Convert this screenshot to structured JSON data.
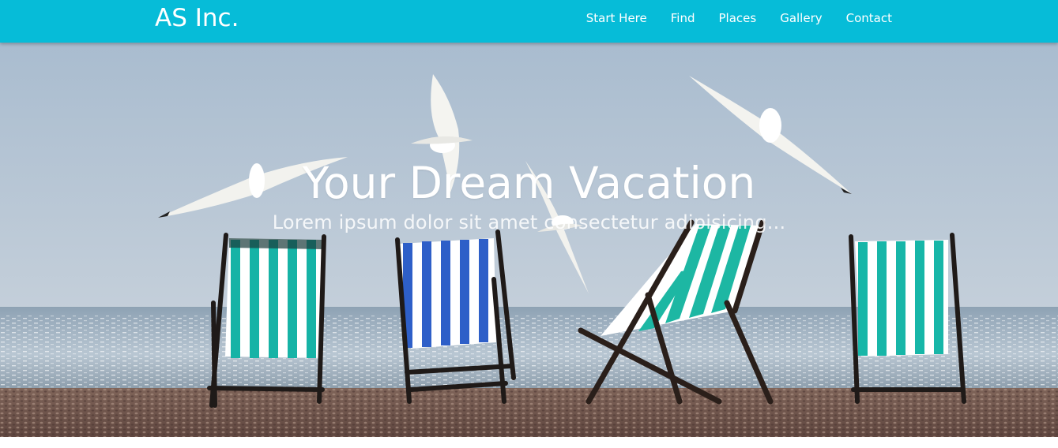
{
  "brand": "AS Inc.",
  "nav": {
    "items": [
      {
        "label": "Start Here"
      },
      {
        "label": "Find"
      },
      {
        "label": "Places"
      },
      {
        "label": "Gallery"
      },
      {
        "label": "Contact"
      }
    ]
  },
  "hero": {
    "title": "Your Dream Vacation",
    "subtitle": "Lorem ipsum dolor sit amet consectetur adipisicing..."
  },
  "colors": {
    "navbar": "#06bcd8",
    "sky": "#b4c4d4",
    "sea": "#7f93a6",
    "pebbles": "#7a5f55"
  }
}
